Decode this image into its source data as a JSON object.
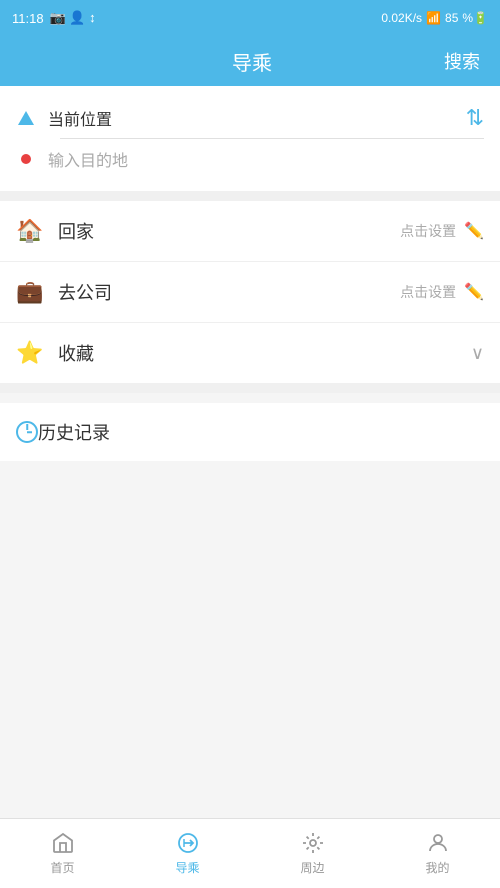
{
  "status": {
    "time": "11:18",
    "signal": "0.02K/s",
    "battery": "85"
  },
  "header": {
    "title": "导乘",
    "search_label": "搜索"
  },
  "search": {
    "current_location": "当前位置",
    "destination_placeholder": "输入目的地"
  },
  "quick_items": [
    {
      "id": "home",
      "label": "回家",
      "action": "点击设置",
      "icon_type": "home"
    },
    {
      "id": "work",
      "label": "去公司",
      "action": "点击设置",
      "icon_type": "work"
    },
    {
      "id": "favorites",
      "label": "收藏",
      "action": "",
      "icon_type": "star"
    }
  ],
  "history": {
    "label": "历史记录",
    "icon": "clock"
  },
  "bottom_nav": [
    {
      "id": "home",
      "label": "首页",
      "icon": "home",
      "active": false
    },
    {
      "id": "guide",
      "label": "导乘",
      "icon": "guide",
      "active": true
    },
    {
      "id": "nearby",
      "label": "周边",
      "icon": "nearby",
      "active": false
    },
    {
      "id": "mine",
      "label": "我的",
      "icon": "mine",
      "active": false
    }
  ]
}
